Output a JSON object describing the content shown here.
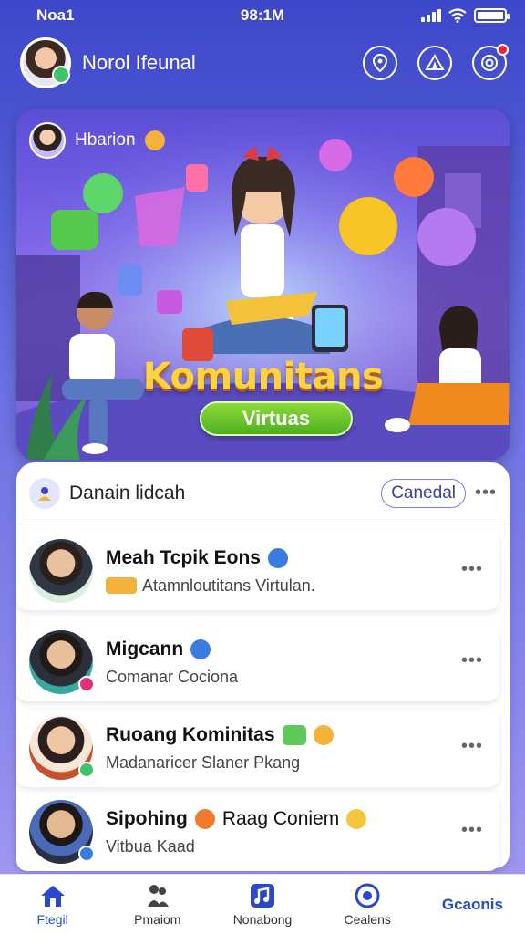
{
  "status_bar": {
    "carrier": "Noa1",
    "time": "98:1M"
  },
  "header": {
    "title": "Norol Ifeunal",
    "icons": [
      "location-pin-icon",
      "tent-icon",
      "target-icon"
    ],
    "notification_color": "#e8233d"
  },
  "hero": {
    "user_name": "Hbarion",
    "title": "Komunitans",
    "badge": "Virtuas",
    "accent": "#ffd23f",
    "badge_color": "#4fae1e"
  },
  "list": {
    "title": "Danain lidcah",
    "cancel_label": "Canedal",
    "more": "•••",
    "items": [
      {
        "name": "Meah Tcpik Eons",
        "sub": "Atamnloutitans Virtulan.",
        "badge_color": "#3a7be0"
      },
      {
        "name": "Migcann",
        "sub": "Comanar Cociona",
        "badge_color": "#e0317a"
      },
      {
        "name": "Ruoang Kominitas",
        "sub": "Madanaricer Slaner Pkang",
        "badge_color": "#3fc26b"
      },
      {
        "name": "Sipohing",
        "name_extra": "Raag Coniem",
        "sub": "Vitbua Kaad",
        "badge_color": "#3a7be0"
      }
    ]
  },
  "tabs": [
    {
      "label": "Ftegil",
      "icon": "home-icon"
    },
    {
      "label": "Pmaiom",
      "icon": "people-icon"
    },
    {
      "label": "Nonabong",
      "icon": "music-icon"
    },
    {
      "label": "Cealens",
      "icon": "chat-icon"
    },
    {
      "label": "Gcaonis",
      "icon": ""
    }
  ]
}
